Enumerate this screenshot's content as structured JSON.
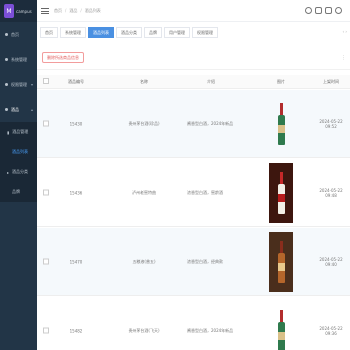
{
  "brand": {
    "logo": "M",
    "name": "campus"
  },
  "sidebar": {
    "items": [
      {
        "label": "首页",
        "icon": "home-icon"
      },
      {
        "label": "系统管理",
        "icon": "settings-icon"
      },
      {
        "label": "权限管理",
        "icon": "lock-icon"
      },
      {
        "label": "酒品",
        "icon": "wine-icon"
      }
    ],
    "submenu_title": "酒品管理",
    "submenu_items": [
      {
        "label": "酒品列表"
      },
      {
        "label": "酒品分类"
      },
      {
        "label": "品牌"
      }
    ]
  },
  "header": {
    "breadcrumb": [
      "首页",
      "酒品",
      "酒品列表"
    ]
  },
  "tabs": [
    {
      "label": "首页"
    },
    {
      "label": "系统管理"
    },
    {
      "label": "酒品列表"
    },
    {
      "label": "酒品分类"
    },
    {
      "label": "品牌"
    },
    {
      "label": "用户管理"
    },
    {
      "label": "权限管理"
    }
  ],
  "toolbar": {
    "delete_label": "删除所选商品信息"
  },
  "table": {
    "headers": [
      "酒品编号",
      "名称",
      "介绍",
      "图片",
      "上架时间"
    ],
    "rows": [
      {
        "num": "15430",
        "name": "贵州茅台酒(珍品)",
        "intro": "酱香型白酒，2024年新品",
        "image": "green",
        "date": "2024-05-22 09:52"
      },
      {
        "num": "15436",
        "name": "泸州老窖特曲",
        "intro": "浓香型白酒，窖龄酒",
        "image": "white",
        "date": "2024-05-22 09:48"
      },
      {
        "num": "15470",
        "name": "五粮液(普五)",
        "intro": "浓香型白酒，经典款",
        "image": "amber",
        "date": "2024-05-22 09:40"
      },
      {
        "num": "15482",
        "name": "贵州茅台酒(飞天)",
        "intro": "酱香型白酒，2024年新品",
        "image": "green",
        "date": "2024-05-22 09:36"
      }
    ]
  },
  "colors": {
    "sidebar": "#223547",
    "accent": "#4a90e2",
    "danger": "#e25c5c"
  }
}
